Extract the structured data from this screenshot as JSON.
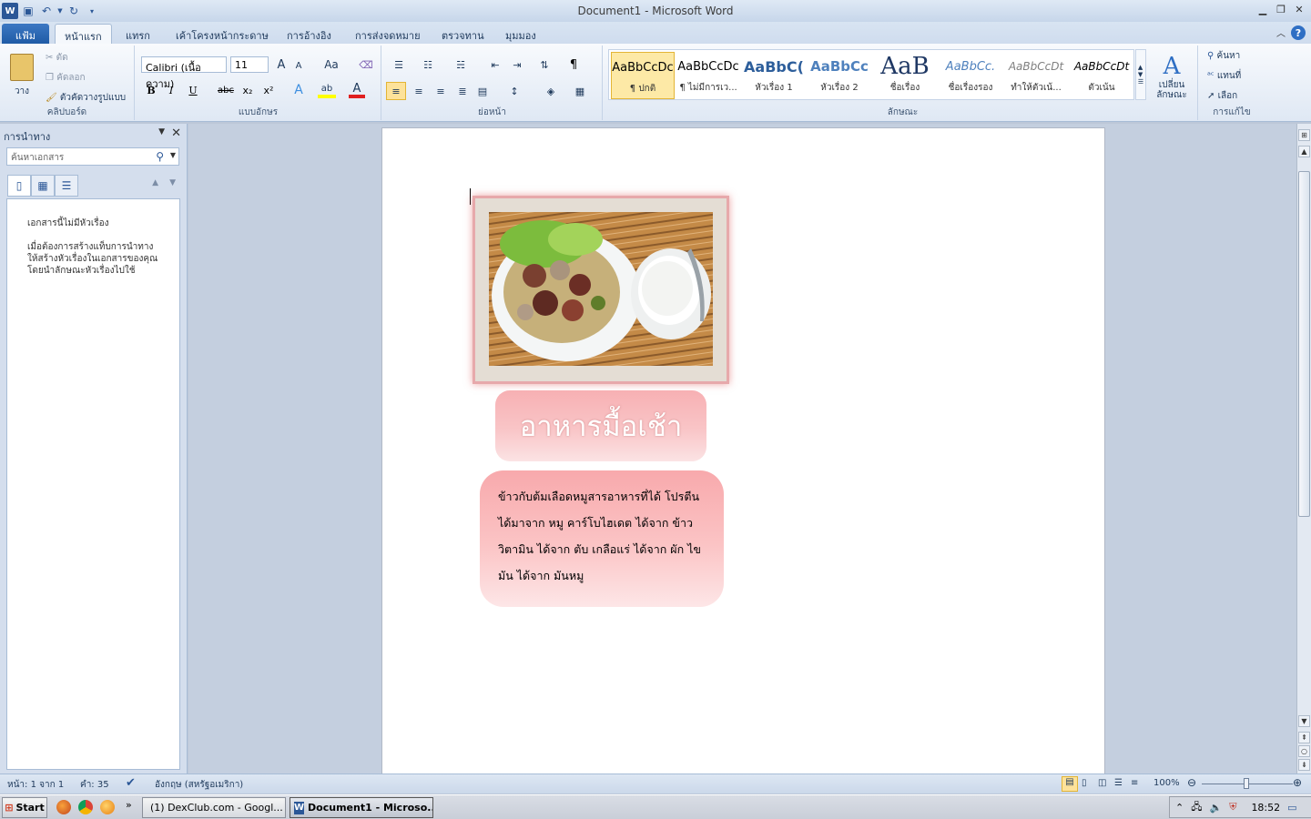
{
  "window": {
    "title": "Document1 - Microsoft Word"
  },
  "qat": {
    "icons": [
      "word-logo-icon",
      "save-icon",
      "undo-icon",
      "redo-icon",
      "customize-icon"
    ]
  },
  "tabs": [
    "แฟ้ม",
    "หน้าแรก",
    "แทรก",
    "เค้าโครงหน้ากระดาษ",
    "การอ้างอิง",
    "การส่งจดหมาย",
    "ตรวจทาน",
    "มุมมอง"
  ],
  "ribbon": {
    "clipboard": {
      "paste": "วาง",
      "cut": "ตัด",
      "copy": "คัดลอก",
      "format_painter": "ตัวคัดวางรูปแบบ",
      "label": "คลิปบอร์ด"
    },
    "font": {
      "name": "Calibri (เนื้อความ)",
      "size": "11",
      "label": "แบบอักษร",
      "grow": "A",
      "shrink": "A",
      "case": "Aa",
      "bold": "B",
      "italic": "I",
      "underline": "U",
      "strike": "abc",
      "sub": "x₂",
      "sup": "x²",
      "effects": "A",
      "highlight": "ab",
      "color": "A"
    },
    "paragraph": {
      "label": "ย่อหน้า",
      "pilcrow": "¶"
    },
    "styles": {
      "label": "ลักษณะ",
      "items": [
        {
          "preview": "AaBbCcDc",
          "name": "¶ ปกติ"
        },
        {
          "preview": "AaBbCcDc",
          "name": "¶ ไม่มีการเว..."
        },
        {
          "preview": "AaBbC(",
          "name": "หัวเรื่อง 1"
        },
        {
          "preview": "AaBbCc",
          "name": "หัวเรื่อง 2"
        },
        {
          "preview": "AaB",
          "name": "ชื่อเรื่อง"
        },
        {
          "preview": "AaBbCc.",
          "name": "ชื่อเรื่องรอง"
        },
        {
          "preview": "AaBbCcDt",
          "name": "ทำให้ตัวเน้..."
        },
        {
          "preview": "AaBbCcDt",
          "name": "ตัวเน้น"
        }
      ],
      "change": "เปลี่ยนลักษณะ"
    },
    "editing": {
      "label": "การแก้ไข",
      "find": "ค้นหา",
      "replace": "แทนที่",
      "select": "เลือก"
    }
  },
  "nav": {
    "title": "การนำทาง",
    "search_placeholder": "ค้นหาเอกสาร",
    "msg1": "เอกสารนี้ไม่มีหัวเรื่อง",
    "msg2": "เมื่อต้องการสร้างแท็บการนำทาง ให้สร้างหัวเรื่องในเอกสารของคุณโดยนำลักษณะหัวเรื่องไปใช้"
  },
  "document": {
    "heading": "อาหารมื้อเช้า",
    "body": "ข้าวกับต้มเลือดหมูสารอาหารที่ได้ โปรตีน ได้มาจาก หมู คาร์โบไฮเดต ได้จาก ข้าว วิตามิน ได้จาก ตับ เกลือแร่ ได้จาก ผัก ไขมัน ได้จาก มันหมู"
  },
  "status": {
    "page": "หน้า: 1 จาก 1",
    "words": "คำ: 35",
    "language": "อังกฤษ (สหรัฐอเมริกา)",
    "zoom": "100%"
  },
  "taskbar": {
    "start": "Start",
    "chrome_task": "(1) DexClub.com - Googl...",
    "word_task": "Document1 - Microso...",
    "clock": "18:52"
  },
  "colors": {
    "accent": "#2b5797",
    "file_tab": "#2a67b4",
    "title_box": "#f7b0b3",
    "body_box": "#f8a9ac"
  }
}
